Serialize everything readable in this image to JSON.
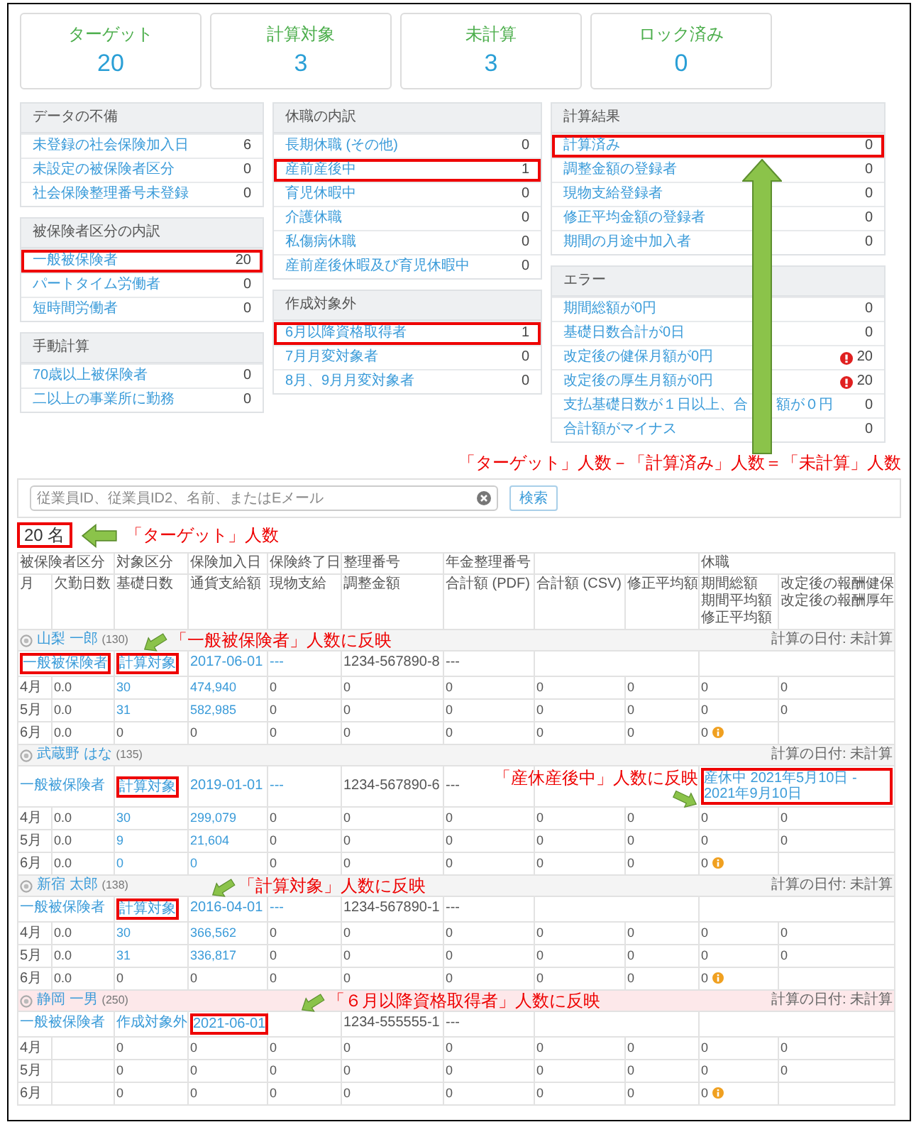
{
  "stats": [
    {
      "label": "ターゲット",
      "value": "20"
    },
    {
      "label": "計算対象",
      "value": "3"
    },
    {
      "label": "未計算",
      "value": "3"
    },
    {
      "label": "ロック済み",
      "value": "0"
    }
  ],
  "panel_columns": [
    [
      {
        "title": "データの不備",
        "items": [
          {
            "label": "未登録の社会保険加入日",
            "count": "6",
            "highlighted": false
          },
          {
            "label": "未設定の被保険者区分",
            "count": "0",
            "highlighted": false
          },
          {
            "label": "社会保険整理番号未登録",
            "count": "0",
            "highlighted": false
          }
        ]
      },
      {
        "title": "被保険者区分の内訳",
        "items": [
          {
            "label": "一般被保険者",
            "count": "20",
            "highlighted": true
          },
          {
            "label": "パートタイム労働者",
            "count": "0",
            "highlighted": false
          },
          {
            "label": "短時間労働者",
            "count": "0",
            "highlighted": false
          }
        ]
      },
      {
        "title": "手動計算",
        "items": [
          {
            "label": "70歳以上被保険者",
            "count": "0",
            "highlighted": false
          },
          {
            "label": "二以上の事業所に勤務",
            "count": "0",
            "highlighted": false
          }
        ]
      }
    ],
    [
      {
        "title": "休職の内訳",
        "items": [
          {
            "label": "長期休職 (その他)",
            "count": "0",
            "highlighted": false
          },
          {
            "label": "産前産後中",
            "count": "1",
            "highlighted": true
          },
          {
            "label": "育児休暇中",
            "count": "0",
            "highlighted": false
          },
          {
            "label": "介護休職",
            "count": "0",
            "highlighted": false
          },
          {
            "label": "私傷病休職",
            "count": "0",
            "highlighted": false
          },
          {
            "label": "産前産後休暇及び育児休暇中",
            "count": "0",
            "highlighted": false
          }
        ]
      },
      {
        "title": "作成対象外",
        "items": [
          {
            "label": "6月以降資格取得者",
            "count": "1",
            "highlighted": true
          },
          {
            "label": "7月月変対象者",
            "count": "0",
            "highlighted": false
          },
          {
            "label": "8月、9月月変対象者",
            "count": "0",
            "highlighted": false
          }
        ]
      }
    ],
    [
      {
        "title": "計算結果",
        "items": [
          {
            "label": "計算済み",
            "count": "0",
            "highlighted": true
          },
          {
            "label": "調整金額の登録者",
            "count": "0",
            "highlighted": false
          },
          {
            "label": "現物支給登録者",
            "count": "0",
            "highlighted": false
          },
          {
            "label": "修正平均金額の登録者",
            "count": "0",
            "highlighted": false
          },
          {
            "label": "期間の月途中加入者",
            "count": "0",
            "highlighted": false
          }
        ]
      },
      {
        "title": "エラー",
        "items": [
          {
            "label": "期間総額が0円",
            "count": "0",
            "highlighted": false,
            "alert": false
          },
          {
            "label": "基礎日数合計が0日",
            "count": "0",
            "highlighted": false,
            "alert": false
          },
          {
            "label": "改定後の健保月額が0円",
            "count": "20",
            "highlighted": false,
            "alert": true
          },
          {
            "label": "改定後の厚生月額が0円",
            "count": "20",
            "highlighted": false,
            "alert": true
          },
          {
            "label": "支払基礎日数が１日以上、合",
            "label_after": "額が０円",
            "count": "0",
            "highlighted": false,
            "alert": false
          },
          {
            "label": "合計額がマイナス",
            "count": "0",
            "highlighted": false,
            "alert": false
          }
        ]
      }
    ]
  ],
  "formula_note": "「ターゲット」人数－「計算済み」人数＝「未計算」人数",
  "search": {
    "placeholder": "従業員ID、従業員ID2、名前、またはEメール",
    "button": "検索"
  },
  "result_count": {
    "count": "20 名",
    "highlighted": true,
    "note": "「ターゲット」人数"
  },
  "table": {
    "header_top": [
      "被保険者区分",
      "対象区分",
      "保険加入日",
      "保険終了日",
      "整理番号",
      "年金整理番号"
    ],
    "header_leave": "休職",
    "header_bottom": [
      "月",
      "欠勤日数",
      "基礎日数",
      "通貨支給額",
      "現物支給",
      "調整金額",
      "合計額 (PDF)",
      "合計額 (CSV)",
      "修正平均額",
      [
        "期間総額",
        "期間平均額",
        "修正平均額"
      ],
      [
        "改定後の報酬健保",
        "改定後の報酬厚年"
      ]
    ],
    "employees": [
      {
        "name": "山梨 一郎",
        "id": "(130)",
        "calc_date": "計算の日付: 未計算",
        "excluded": false,
        "info": {
          "category": {
            "text": "一般被保険者",
            "link": true,
            "highlighted": true,
            "note": "「一般被保険者」人数に反映"
          },
          "target": {
            "text": "計算対象",
            "link": true,
            "highlighted": true
          },
          "join_date": {
            "text": "2017-06-01",
            "link": true,
            "highlighted": false
          },
          "end_date": {
            "text": "---",
            "link": true,
            "highlighted": false
          },
          "number": {
            "text": "1234-567890-8",
            "link": false,
            "highlighted": false
          },
          "pension_number": {
            "text": "---",
            "link": false,
            "highlighted": false
          }
        },
        "months": [
          {
            "month": "4月",
            "absent": "0.0",
            "days": "30",
            "pay": "474,940",
            "linked": true,
            "amounts": [
              "0",
              "0",
              "0",
              "0",
              "0",
              "0",
              "0"
            ],
            "notice": false
          },
          {
            "month": "5月",
            "absent": "0.0",
            "days": "31",
            "pay": "582,985",
            "linked": true,
            "amounts": [
              "0",
              "0",
              "0",
              "0",
              "0",
              "0",
              "0"
            ],
            "notice": false
          },
          {
            "month": "6月",
            "absent": "0.0",
            "days": "0",
            "pay": "0",
            "linked": false,
            "amounts": [
              "0",
              "0",
              "0",
              "0",
              "0",
              "0"
            ],
            "notice": true
          }
        ]
      },
      {
        "name": "武蔵野 はな",
        "id": "(135)",
        "calc_date": "計算の日付: 未計算",
        "excluded": false,
        "info": {
          "category": {
            "text": "一般被保険者",
            "link": true,
            "highlighted": false
          },
          "target": {
            "text": "計算対象",
            "link": true,
            "highlighted": true
          },
          "join_date": {
            "text": "2019-01-01",
            "link": true,
            "highlighted": false
          },
          "end_date": {
            "text": "---",
            "link": true,
            "highlighted": false
          },
          "number": {
            "text": "1234-567890-6",
            "link": false,
            "highlighted": false
          },
          "pension_number": {
            "text": "---",
            "link": false,
            "highlighted": false
          }
        },
        "leave": {
          "text": "産休中 2021年5月10日 - 2021年9月10日",
          "link": true,
          "highlighted": true,
          "note": "「産休産後中」人数に反映"
        },
        "months": [
          {
            "month": "4月",
            "absent": "0.0",
            "days": "30",
            "pay": "299,079",
            "linked": true,
            "amounts": [
              "0",
              "0",
              "0",
              "0",
              "0",
              "0",
              "0"
            ],
            "notice": false
          },
          {
            "month": "5月",
            "absent": "0.0",
            "days": "9",
            "pay": "21,604",
            "linked": true,
            "amounts": [
              "0",
              "0",
              "0",
              "0",
              "0",
              "0",
              "0"
            ],
            "notice": false
          },
          {
            "month": "6月",
            "absent": "0.0",
            "days": "0",
            "pay": "0",
            "linked": true,
            "amounts": [
              "0",
              "0",
              "0",
              "0",
              "0",
              "0"
            ],
            "notice": true
          }
        ]
      },
      {
        "name": "新宿 太郎",
        "id": "(138)",
        "calc_date": "計算の日付: 未計算",
        "excluded": false,
        "info": {
          "category": {
            "text": "一般被保険者",
            "link": true,
            "highlighted": false
          },
          "target": {
            "text": "計算対象",
            "link": true,
            "highlighted": true,
            "note": "「計算対象」人数に反映"
          },
          "join_date": {
            "text": "2016-04-01",
            "link": true,
            "highlighted": false
          },
          "end_date": {
            "text": "---",
            "link": true,
            "highlighted": false
          },
          "number": {
            "text": "1234-567890-1",
            "link": false,
            "highlighted": false
          },
          "pension_number": {
            "text": "---",
            "link": false,
            "highlighted": false
          }
        },
        "months": [
          {
            "month": "4月",
            "absent": "0.0",
            "days": "30",
            "pay": "366,562",
            "linked": true,
            "amounts": [
              "0",
              "0",
              "0",
              "0",
              "0",
              "0",
              "0"
            ],
            "notice": false
          },
          {
            "month": "5月",
            "absent": "0.0",
            "days": "31",
            "pay": "336,817",
            "linked": true,
            "amounts": [
              "0",
              "0",
              "0",
              "0",
              "0",
              "0",
              "0"
            ],
            "notice": false
          },
          {
            "month": "6月",
            "absent": "0.0",
            "days": "0",
            "pay": "0",
            "linked": false,
            "amounts": [
              "0",
              "0",
              "0",
              "0",
              "0",
              "0"
            ],
            "notice": true
          }
        ]
      },
      {
        "name": "静岡 一男",
        "id": "(250)",
        "calc_date": "計算の日付: 未計算",
        "excluded": true,
        "info": {
          "category": {
            "text": "一般被保険者",
            "link": true,
            "highlighted": false
          },
          "target": {
            "text": "作成対象外",
            "link": true,
            "highlighted": false
          },
          "join_date": {
            "text": "2021-06-01",
            "link": true,
            "highlighted": true,
            "note": "「６月以降資格取得者」人数に反映"
          },
          "number": {
            "text": "1234-555555-1",
            "link": false,
            "highlighted": false
          },
          "pension_number": {
            "text": "---",
            "link": false,
            "highlighted": false
          }
        },
        "months": [
          {
            "month": "4月",
            "days": "0",
            "pay": "0",
            "linked": false,
            "amounts": [
              "0",
              "0",
              "0",
              "0",
              "0",
              "0",
              "0"
            ],
            "notice": false
          },
          {
            "month": "5月",
            "days": "0",
            "pay": "0",
            "linked": false,
            "amounts": [
              "0",
              "0",
              "0",
              "0",
              "0",
              "0",
              "0"
            ],
            "notice": false
          },
          {
            "month": "6月",
            "days": "0",
            "pay": "0",
            "linked": false,
            "amounts": [
              "0",
              "0",
              "0",
              "0",
              "0",
              "0"
            ],
            "notice": true
          }
        ]
      }
    ]
  }
}
